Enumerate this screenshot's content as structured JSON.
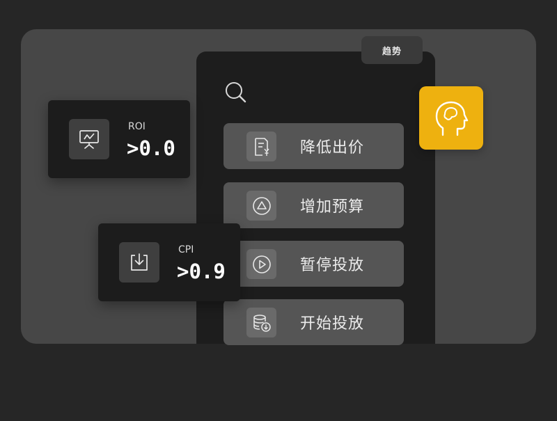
{
  "trend_tab": {
    "label": "趋势"
  },
  "actions": [
    {
      "label": "降低出价",
      "icon": "bill-yen-icon"
    },
    {
      "label": "增加预算",
      "icon": "triangle-circle-icon"
    },
    {
      "label": "暂停投放",
      "icon": "play-circle-icon"
    },
    {
      "label": "开始投放",
      "icon": "database-download-icon"
    }
  ],
  "metrics": [
    {
      "label": "ROI",
      "value": ">0.0",
      "icon": "presentation-chart-icon"
    },
    {
      "label": "CPI",
      "value": ">0.9",
      "icon": "download-tray-icon"
    }
  ],
  "ai_badge": {
    "icon": "head-brain-icon",
    "color": "#EEB10F"
  }
}
